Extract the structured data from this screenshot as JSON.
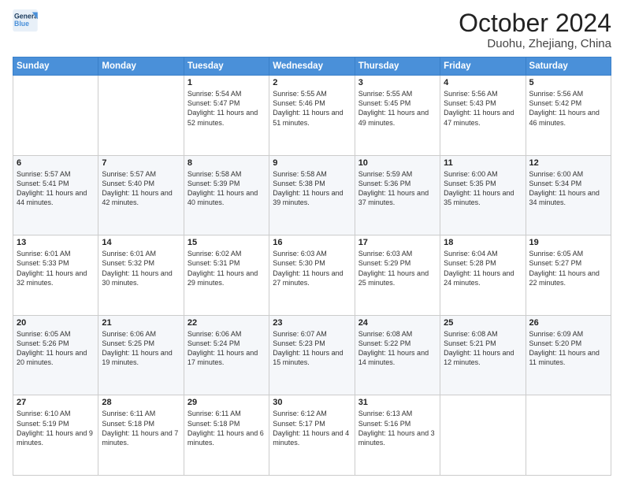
{
  "header": {
    "logo_line1": "General",
    "logo_line2": "Blue",
    "month": "October 2024",
    "location": "Duohu, Zhejiang, China"
  },
  "weekdays": [
    "Sunday",
    "Monday",
    "Tuesday",
    "Wednesday",
    "Thursday",
    "Friday",
    "Saturday"
  ],
  "weeks": [
    [
      null,
      null,
      {
        "day": "1",
        "sunrise": "5:54 AM",
        "sunset": "5:47 PM",
        "daylight": "11 hours and 52 minutes."
      },
      {
        "day": "2",
        "sunrise": "5:55 AM",
        "sunset": "5:46 PM",
        "daylight": "11 hours and 51 minutes."
      },
      {
        "day": "3",
        "sunrise": "5:55 AM",
        "sunset": "5:45 PM",
        "daylight": "11 hours and 49 minutes."
      },
      {
        "day": "4",
        "sunrise": "5:56 AM",
        "sunset": "5:43 PM",
        "daylight": "11 hours and 47 minutes."
      },
      {
        "day": "5",
        "sunrise": "5:56 AM",
        "sunset": "5:42 PM",
        "daylight": "11 hours and 46 minutes."
      }
    ],
    [
      {
        "day": "6",
        "sunrise": "5:57 AM",
        "sunset": "5:41 PM",
        "daylight": "11 hours and 44 minutes."
      },
      {
        "day": "7",
        "sunrise": "5:57 AM",
        "sunset": "5:40 PM",
        "daylight": "11 hours and 42 minutes."
      },
      {
        "day": "8",
        "sunrise": "5:58 AM",
        "sunset": "5:39 PM",
        "daylight": "11 hours and 40 minutes."
      },
      {
        "day": "9",
        "sunrise": "5:58 AM",
        "sunset": "5:38 PM",
        "daylight": "11 hours and 39 minutes."
      },
      {
        "day": "10",
        "sunrise": "5:59 AM",
        "sunset": "5:36 PM",
        "daylight": "11 hours and 37 minutes."
      },
      {
        "day": "11",
        "sunrise": "6:00 AM",
        "sunset": "5:35 PM",
        "daylight": "11 hours and 35 minutes."
      },
      {
        "day": "12",
        "sunrise": "6:00 AM",
        "sunset": "5:34 PM",
        "daylight": "11 hours and 34 minutes."
      }
    ],
    [
      {
        "day": "13",
        "sunrise": "6:01 AM",
        "sunset": "5:33 PM",
        "daylight": "11 hours and 32 minutes."
      },
      {
        "day": "14",
        "sunrise": "6:01 AM",
        "sunset": "5:32 PM",
        "daylight": "11 hours and 30 minutes."
      },
      {
        "day": "15",
        "sunrise": "6:02 AM",
        "sunset": "5:31 PM",
        "daylight": "11 hours and 29 minutes."
      },
      {
        "day": "16",
        "sunrise": "6:03 AM",
        "sunset": "5:30 PM",
        "daylight": "11 hours and 27 minutes."
      },
      {
        "day": "17",
        "sunrise": "6:03 AM",
        "sunset": "5:29 PM",
        "daylight": "11 hours and 25 minutes."
      },
      {
        "day": "18",
        "sunrise": "6:04 AM",
        "sunset": "5:28 PM",
        "daylight": "11 hours and 24 minutes."
      },
      {
        "day": "19",
        "sunrise": "6:05 AM",
        "sunset": "5:27 PM",
        "daylight": "11 hours and 22 minutes."
      }
    ],
    [
      {
        "day": "20",
        "sunrise": "6:05 AM",
        "sunset": "5:26 PM",
        "daylight": "11 hours and 20 minutes."
      },
      {
        "day": "21",
        "sunrise": "6:06 AM",
        "sunset": "5:25 PM",
        "daylight": "11 hours and 19 minutes."
      },
      {
        "day": "22",
        "sunrise": "6:06 AM",
        "sunset": "5:24 PM",
        "daylight": "11 hours and 17 minutes."
      },
      {
        "day": "23",
        "sunrise": "6:07 AM",
        "sunset": "5:23 PM",
        "daylight": "11 hours and 15 minutes."
      },
      {
        "day": "24",
        "sunrise": "6:08 AM",
        "sunset": "5:22 PM",
        "daylight": "11 hours and 14 minutes."
      },
      {
        "day": "25",
        "sunrise": "6:08 AM",
        "sunset": "5:21 PM",
        "daylight": "11 hours and 12 minutes."
      },
      {
        "day": "26",
        "sunrise": "6:09 AM",
        "sunset": "5:20 PM",
        "daylight": "11 hours and 11 minutes."
      }
    ],
    [
      {
        "day": "27",
        "sunrise": "6:10 AM",
        "sunset": "5:19 PM",
        "daylight": "11 hours and 9 minutes."
      },
      {
        "day": "28",
        "sunrise": "6:11 AM",
        "sunset": "5:18 PM",
        "daylight": "11 hours and 7 minutes."
      },
      {
        "day": "29",
        "sunrise": "6:11 AM",
        "sunset": "5:18 PM",
        "daylight": "11 hours and 6 minutes."
      },
      {
        "day": "30",
        "sunrise": "6:12 AM",
        "sunset": "5:17 PM",
        "daylight": "11 hours and 4 minutes."
      },
      {
        "day": "31",
        "sunrise": "6:13 AM",
        "sunset": "5:16 PM",
        "daylight": "11 hours and 3 minutes."
      },
      null,
      null
    ]
  ]
}
